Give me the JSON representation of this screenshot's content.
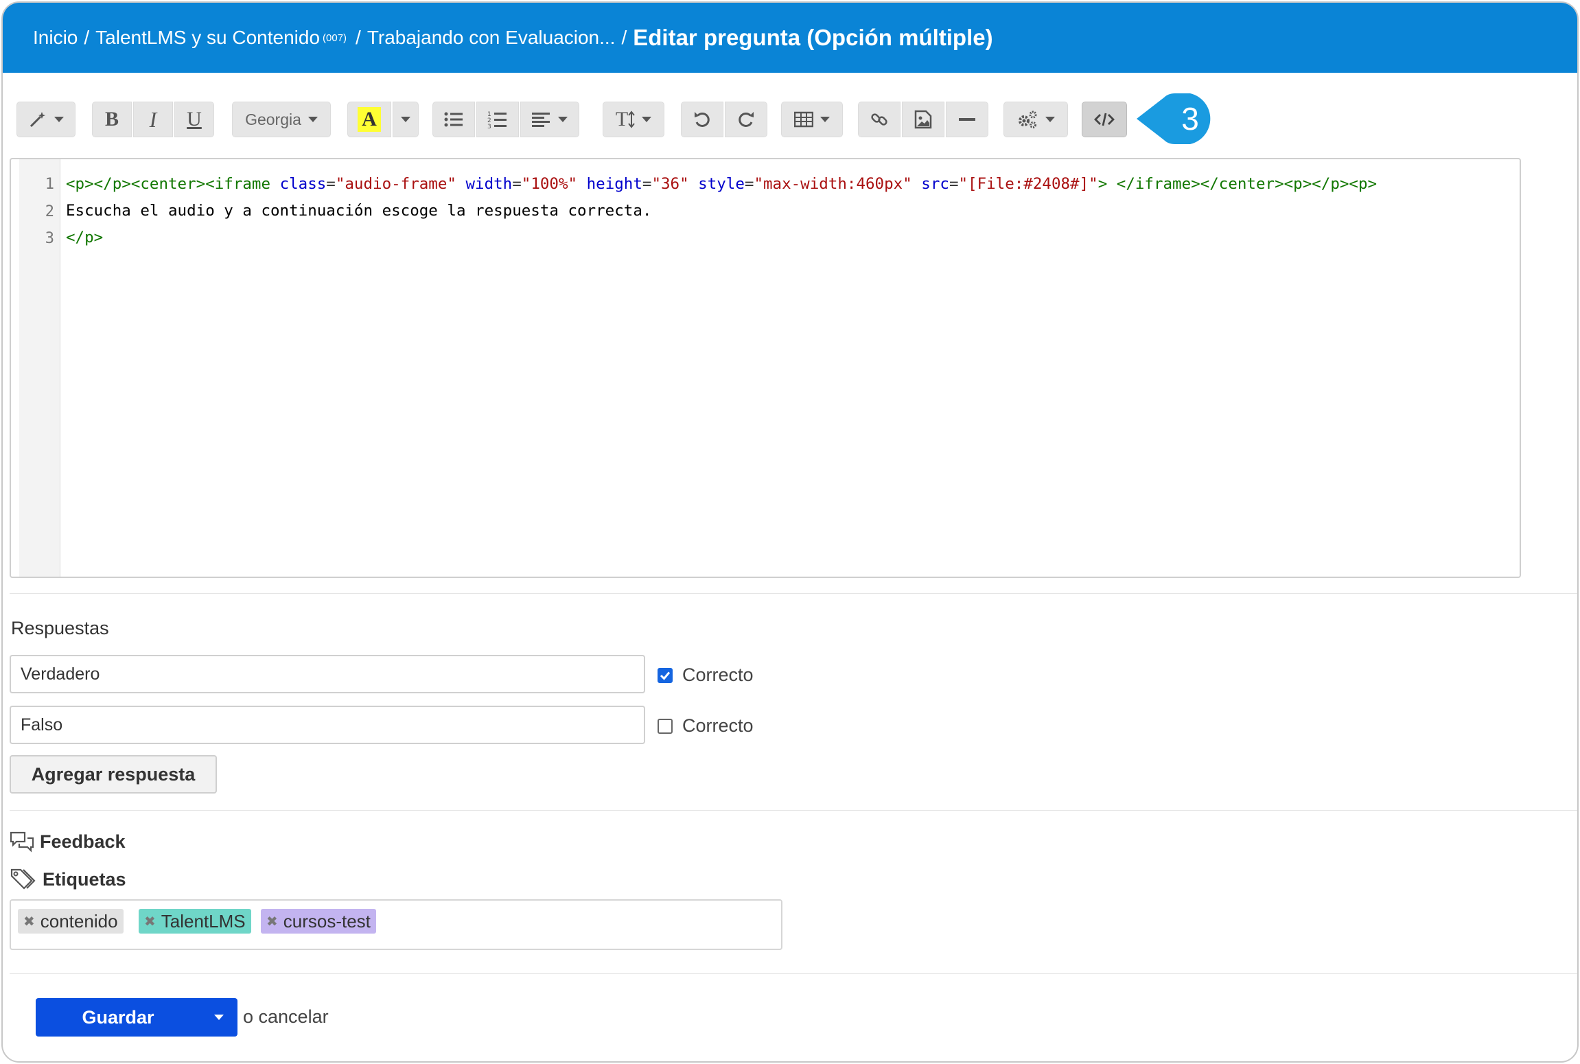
{
  "header": {
    "crumb_home": "Inicio",
    "crumb_course": "TalentLMS y su Contenido",
    "crumb_course_code": "(007)",
    "crumb_unit": "Trabajando con Evaluacion...",
    "separator": "/",
    "current": "Editar pregunta (Opción múltiple)"
  },
  "toolbar": {
    "font_name": "Georgia",
    "bold": "B",
    "italic": "I",
    "underline": "U",
    "highlight": "A",
    "textsize": "T"
  },
  "callout": {
    "number": "3"
  },
  "editor": {
    "line_numbers": [
      "1",
      "2",
      "3"
    ],
    "line2": "Escucha el audio y a continuación escoge la respuesta correcta.",
    "line1": {
      "t1": "<p></p><center><iframe ",
      "a1": "class",
      "v1": "\"audio-frame\"",
      "a2": "width",
      "v2": "\"100%\"",
      "a3": "height",
      "v3": "\"36\"",
      "a4": "style",
      "v4": "\"max-width:460px\"",
      "a5": "src",
      "v5": "\"[File:#2408#]\"",
      "t2": "> </iframe></center><p></p><p>"
    },
    "line3": "</p>"
  },
  "answers": {
    "title": "Respuestas",
    "items": [
      {
        "value": "Verdadero",
        "correct_label": "Correcto",
        "checked": true
      },
      {
        "value": "Falso",
        "correct_label": "Correcto",
        "checked": false
      }
    ],
    "add_button": "Agregar respuesta"
  },
  "feedback": {
    "label": "Feedback"
  },
  "tags": {
    "label": "Etiquetas",
    "items": [
      {
        "name": "contenido",
        "color": "#e2e2e2"
      },
      {
        "name": "TalentLMS",
        "color": "#6fd6c8"
      },
      {
        "name": "cursos-test",
        "color": "#c3b4f0"
      }
    ]
  },
  "footer": {
    "save": "Guardar",
    "cancel": "o cancelar"
  },
  "colors": {
    "header_bg": "#0a84d6",
    "save_bg": "#0b4fe0",
    "callout": "#1a9be0"
  }
}
